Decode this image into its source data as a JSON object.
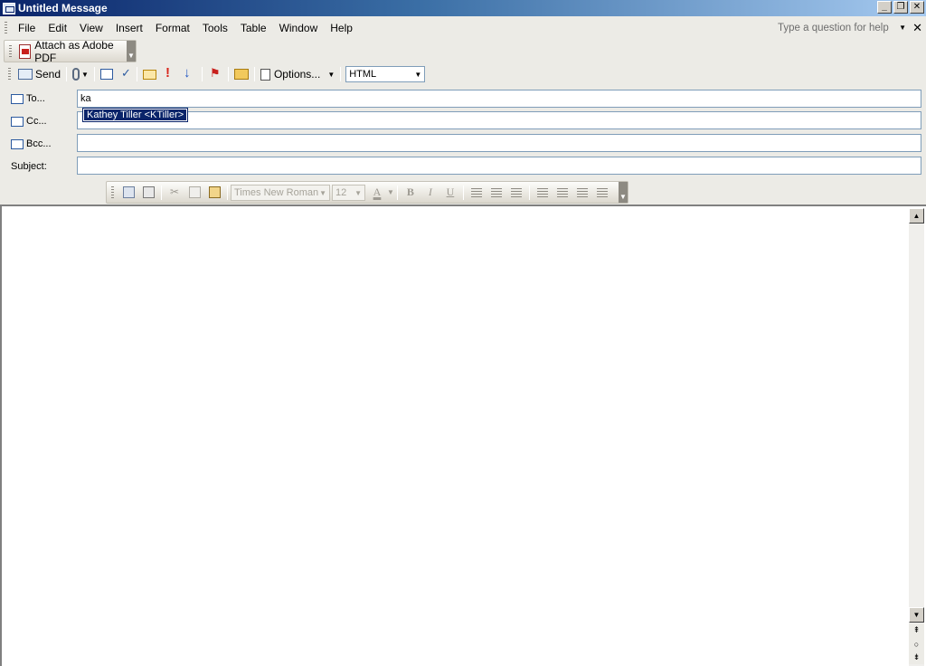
{
  "window": {
    "title": "Untitled Message",
    "minimize": "_",
    "restore": "❐",
    "close": "✕"
  },
  "menu": {
    "items": [
      "File",
      "Edit",
      "View",
      "Insert",
      "Format",
      "Tools",
      "Table",
      "Window",
      "Help"
    ],
    "help_placeholder": "Type a question for help",
    "close": "✕"
  },
  "pdf_toolbar": {
    "attach_label": "Attach as Adobe PDF"
  },
  "standard_toolbar": {
    "send_label": "Send",
    "options_label": "Options...",
    "format_value": "HTML"
  },
  "fields": {
    "to_label": "To...",
    "cc_label": "Cc...",
    "bcc_label": "Bcc...",
    "subject_label": "Subject:",
    "to_value": "ka",
    "cc_value": "",
    "bcc_value": "",
    "subject_value": ""
  },
  "autocomplete": {
    "suggestion": "Kathey Tiller  <KTiller>"
  },
  "format_toolbar": {
    "font_name": "Times New Roman",
    "font_size": "12",
    "font_color_glyph": "A",
    "bold_glyph": "B",
    "italic_glyph": "I",
    "underline_glyph": "U"
  },
  "icons": {
    "send": "send-icon",
    "attach": "paperclip-icon",
    "address_book": "address-book-icon",
    "check_names": "check-names-icon",
    "signature": "signature-icon",
    "importance_high": "importance-high-icon",
    "importance_low": "importance-low-icon",
    "flag": "flag-icon",
    "permission": "permission-icon",
    "options": "options-icon"
  },
  "colors": {
    "title_gradient_start": "#0a246a",
    "title_gradient_end": "#a6caf0",
    "selection": "#0a246a",
    "toolbar_bg": "#ecebe6"
  }
}
